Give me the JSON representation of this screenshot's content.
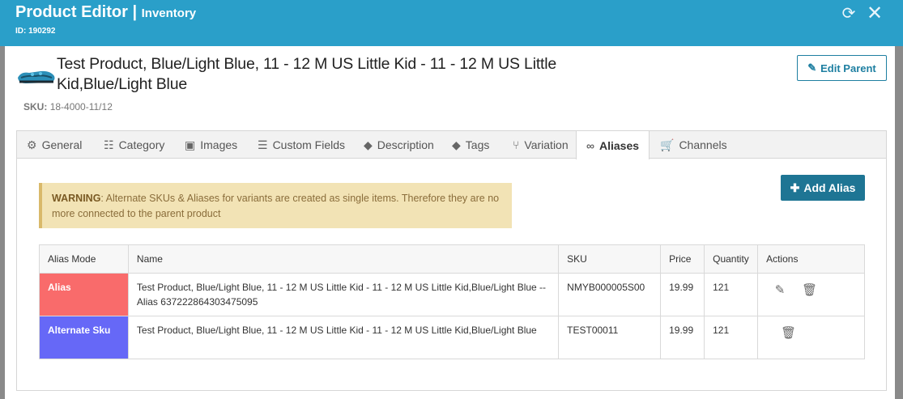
{
  "header": {
    "title": "Product Editor",
    "separator": " | ",
    "subtitle": "Inventory",
    "id_text": "ID: 190292"
  },
  "product": {
    "title": "Test Product, Blue/Light Blue, 11 - 12 M US Little Kid - 11 - 12 M US Little Kid,Blue/Light Blue",
    "sku_label": "SKU:",
    "sku_value": "18-4000-11/12"
  },
  "buttons": {
    "edit_parent": "Edit Parent",
    "add_alias": "Add Alias"
  },
  "tabs": [
    {
      "label": "General",
      "icon": "gears-icon"
    },
    {
      "label": "Category",
      "icon": "sitemap-icon"
    },
    {
      "label": "Images",
      "icon": "image-icon"
    },
    {
      "label": "Custom Fields",
      "icon": "list-icon"
    },
    {
      "label": "Description",
      "icon": "tag-icon"
    },
    {
      "label": "Tags",
      "icon": "tags-icon"
    },
    {
      "label": "Variation",
      "icon": "code-fork-icon"
    },
    {
      "label": "Aliases",
      "icon": "link-icon",
      "active": true
    },
    {
      "label": "Channels",
      "icon": "cart-icon"
    }
  ],
  "warning": {
    "label": "WARNING",
    "text": ": Alternate SKUs & Aliases for variants are created as single items. Therefore they are no more connected to the parent product"
  },
  "table": {
    "columns": [
      "Alias Mode",
      "Name",
      "SKU",
      "Price",
      "Quantity",
      "Actions"
    ],
    "rows": [
      {
        "mode": "Alias",
        "name": "Test Product, Blue/Light Blue, 11 - 12 M US Little Kid - 11 - 12 M US Little Kid,Blue/Light Blue --Alias 637222864303475095",
        "sku": "NMYB000005S00",
        "price": "19.99",
        "quantity": "121"
      },
      {
        "mode": "Alternate Sku",
        "name": "Test Product, Blue/Light Blue, 11 - 12 M US Little Kid - 11 - 12 M US Little Kid,Blue/Light Blue",
        "sku": "TEST00011",
        "price": "19.99",
        "quantity": "121"
      }
    ]
  },
  "colors": {
    "header_bg": "#2a9fc9",
    "alias_badge": "#f96b6b",
    "alternate_badge": "#6668f7",
    "primary_button": "#1e7594"
  }
}
